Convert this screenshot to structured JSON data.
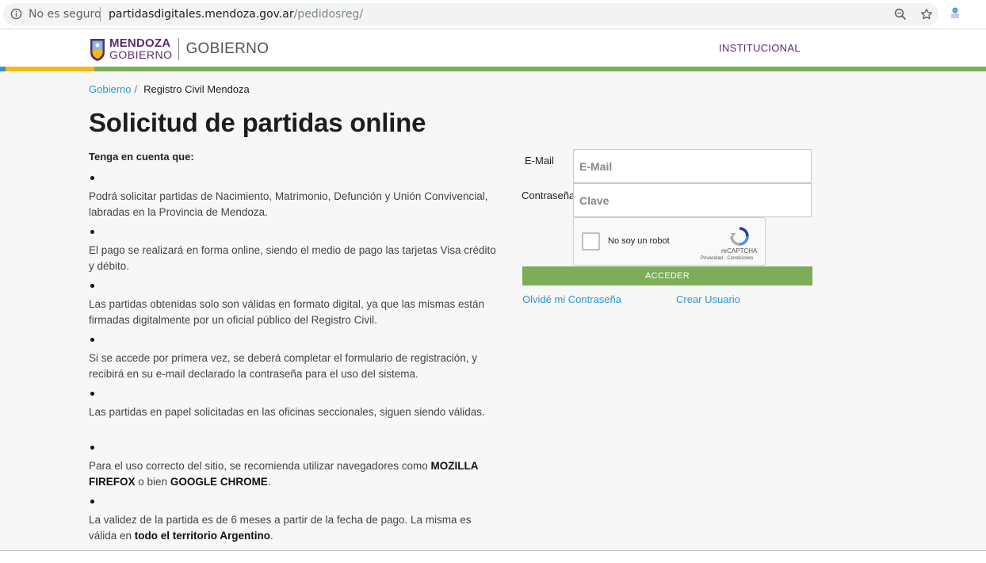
{
  "browser": {
    "security_label": "No es seguro",
    "url_host": "partidasdigitales.mendoza.gov.ar",
    "url_path": "/pedidosreg/"
  },
  "header": {
    "logo_line1": "MENDOZA",
    "logo_line2": "GOBIERNO",
    "logo_section": "GOBIERNO",
    "nav_item": "INSTITUCIONAL",
    "colors": {
      "brand": "#5a2d6e",
      "accent_green": "#7cad59",
      "accent_yellow": "#f4b916",
      "accent_blue": "#3a8fd9"
    }
  },
  "breadcrumb": {
    "items": [
      {
        "label": "Gobierno"
      },
      {
        "label": "Registro Civil Mendoza"
      }
    ],
    "separator": "/"
  },
  "page": {
    "title": "Solicitud de partidas online",
    "notice_heading": "Tenga en cuenta que:",
    "notices": [
      {
        "parts": [
          {
            "text": "Podrá solicitar partidas de Nacimiento, Matrimonio, Defunción y Unión Convivencial, labradas en la Provincia de Mendoza."
          }
        ]
      },
      {
        "parts": [
          {
            "text": "El pago se realizará en forma online, siendo el medio de pago las tarjetas Visa crédito y débito."
          }
        ]
      },
      {
        "parts": [
          {
            "text": "Las partidas obtenidas solo son válidas en formato digital, ya que las mismas están firmadas digitalmente por un oficial público del Registro Civil."
          }
        ]
      },
      {
        "parts": [
          {
            "text": "Si se accede por primera vez, se deberá completar el formulario de registración, y recibirá en su e-mail declarado la contraseña para el uso del sistema."
          }
        ]
      },
      {
        "parts": [
          {
            "text": "Las partidas en papel solicitadas en las oficinas seccionales, siguen siendo válidas."
          }
        ]
      },
      {
        "parts": [
          {
            "text": "Para el uso correcto del sitio, se recomienda utilizar navegadores como "
          },
          {
            "text": "MOZILLA FIREFOX",
            "bold": true
          },
          {
            "text": " o bien "
          },
          {
            "text": "GOOGLE CHROME",
            "bold": true
          },
          {
            "text": "."
          }
        ]
      },
      {
        "parts": [
          {
            "text": "La validez de la partida es de 6 meses a partir de la fecha de pago. La misma es válida en "
          },
          {
            "text": "todo el territorio Argentino",
            "bold": true
          },
          {
            "text": "."
          }
        ]
      }
    ]
  },
  "login": {
    "email_label": "E-Mail",
    "email_placeholder": "E-Mail",
    "email_value": "",
    "password_label": "Contraseña",
    "password_placeholder": "Clave",
    "password_value": "",
    "captcha": {
      "label": "No soy un robot",
      "brand": "reCAPTCHA",
      "links": "Privacidad - Condiciones",
      "checked": false
    },
    "submit_label": "ACCEDER",
    "forgot_link": "Olvidé mi Contraseña",
    "register_link": "Crear Usuario"
  }
}
